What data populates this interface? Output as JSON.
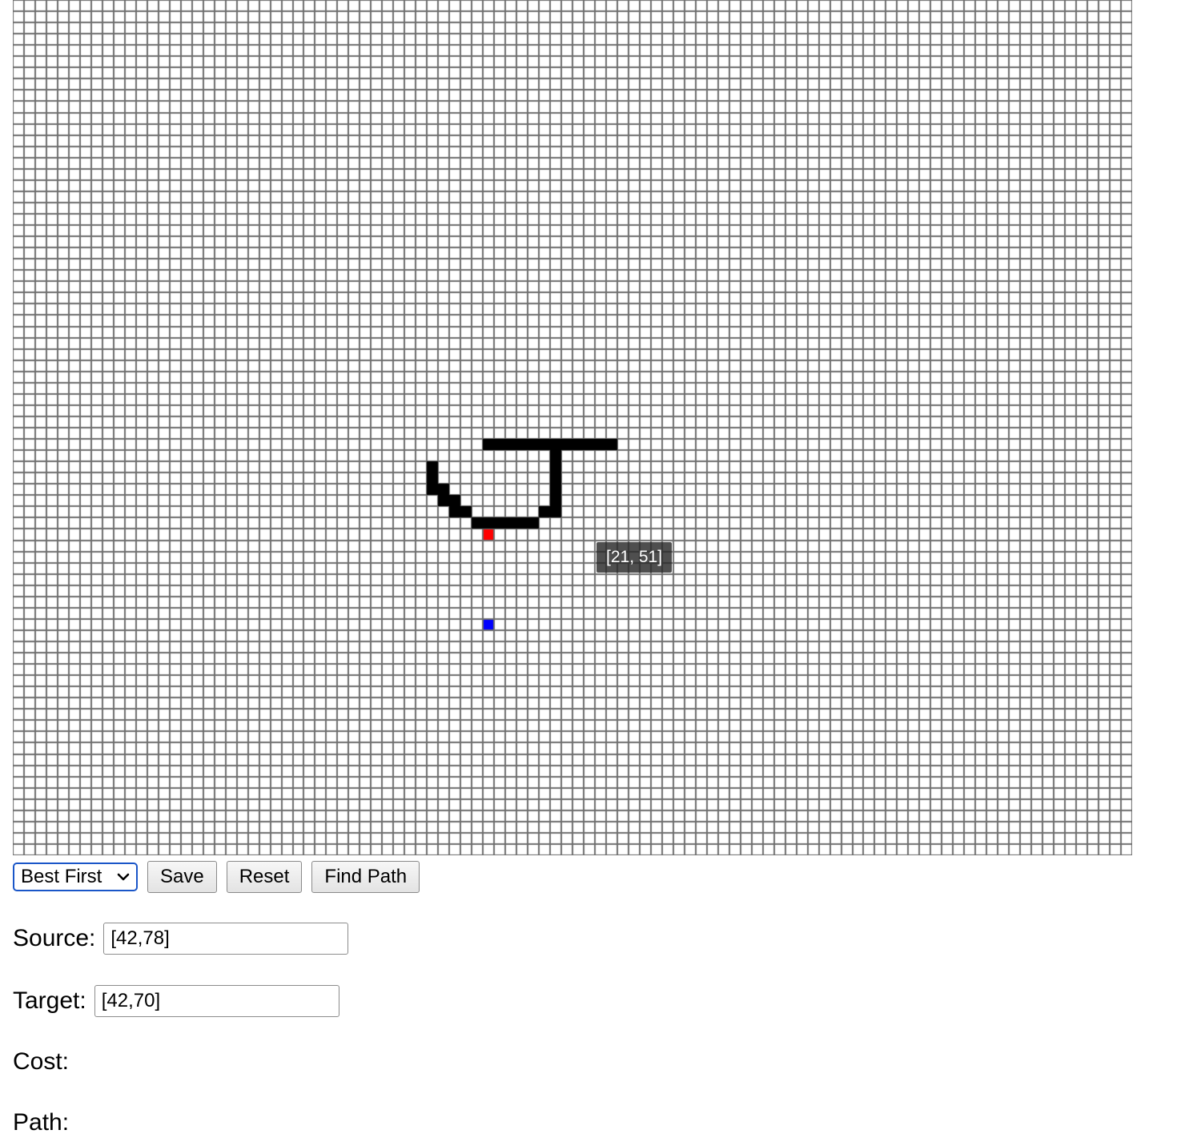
{
  "grid": {
    "columns": 100,
    "rows": 76,
    "colors": {
      "empty": "#ffffff",
      "gridline": "#6e6e6e",
      "wall": "#000000",
      "source": "#ff0000",
      "target": "#0000ff"
    },
    "walls": [
      [
        42,
        39
      ],
      [
        43,
        39
      ],
      [
        44,
        39
      ],
      [
        45,
        39
      ],
      [
        46,
        39
      ],
      [
        47,
        39
      ],
      [
        48,
        39
      ],
      [
        49,
        39
      ],
      [
        50,
        39
      ],
      [
        51,
        39
      ],
      [
        52,
        39
      ],
      [
        53,
        39
      ],
      [
        48,
        40
      ],
      [
        48,
        41
      ],
      [
        48,
        42
      ],
      [
        48,
        43
      ],
      [
        48,
        44
      ],
      [
        48,
        45
      ],
      [
        47,
        45
      ],
      [
        46,
        46
      ],
      [
        45,
        46
      ],
      [
        44,
        46
      ],
      [
        43,
        46
      ],
      [
        42,
        46
      ],
      [
        41,
        46
      ],
      [
        40,
        45
      ],
      [
        39,
        45
      ],
      [
        39,
        44
      ],
      [
        38,
        44
      ],
      [
        38,
        43
      ],
      [
        37,
        43
      ],
      [
        37,
        42
      ],
      [
        37,
        41
      ]
    ],
    "source_cell": [
      42,
      47
    ],
    "target_cell": [
      42,
      55
    ]
  },
  "tooltip": {
    "text": "[21, 51]"
  },
  "controls": {
    "algorithm_selected": "Best First",
    "save_label": "Save",
    "reset_label": "Reset",
    "find_path_label": "Find Path"
  },
  "source": {
    "label": "Source:",
    "value": "[42,78]"
  },
  "target": {
    "label": "Target:",
    "value": "[42,70]"
  },
  "cost": {
    "label": "Cost:"
  },
  "path": {
    "label": "Path:"
  }
}
